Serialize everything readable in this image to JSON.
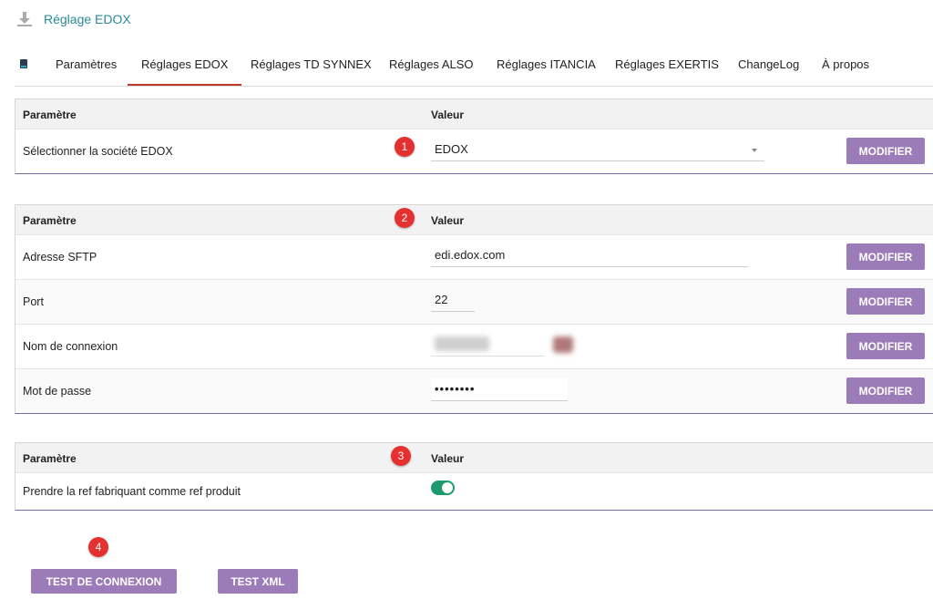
{
  "page": {
    "title": "Réglage EDOX"
  },
  "tabs": [
    {
      "label": "Paramètres"
    },
    {
      "label": "Réglages EDOX"
    },
    {
      "label": "Réglages TD SYNNEX"
    },
    {
      "label": "Réglages ALSO"
    },
    {
      "label": "Réglages ITANCIA"
    },
    {
      "label": "Réglages EXERTIS"
    },
    {
      "label": "ChangeLog"
    },
    {
      "label": "À propos"
    }
  ],
  "active_tab": "Réglages EDOX",
  "headers": {
    "param": "Paramètre",
    "value": "Valeur"
  },
  "panel1": {
    "rows": [
      {
        "label": "Sélectionner la société EDOX",
        "value": "EDOX",
        "button": "MODIFIER"
      }
    ]
  },
  "panel2": {
    "rows": [
      {
        "label": "Adresse SFTP",
        "value": "edi.edox.com",
        "button": "MODIFIER"
      },
      {
        "label": "Port",
        "value": "22",
        "button": "MODIFIER"
      },
      {
        "label": "Nom de connexion",
        "value": "",
        "button": "MODIFIER"
      },
      {
        "label": "Mot de passe",
        "value": "••••••••",
        "button": "MODIFIER"
      }
    ]
  },
  "panel3": {
    "rows": [
      {
        "label": "Prendre la ref fabriquant comme ref produit",
        "toggle_on": true
      }
    ]
  },
  "badges": [
    "1",
    "2",
    "3",
    "4"
  ],
  "buttons": {
    "test_connexion": "TEST DE CONNEXION",
    "test_xml": "TEST XML"
  },
  "colors": {
    "accent": "#9b7bb8",
    "active_tab": "#c0392b",
    "toggle": "#1e9b6c",
    "badge": "#e53030",
    "title": "#2a8a9a"
  },
  "icons": {
    "title": "download-icon",
    "tab_first": "book-icon",
    "select": "chevron-down-icon"
  }
}
